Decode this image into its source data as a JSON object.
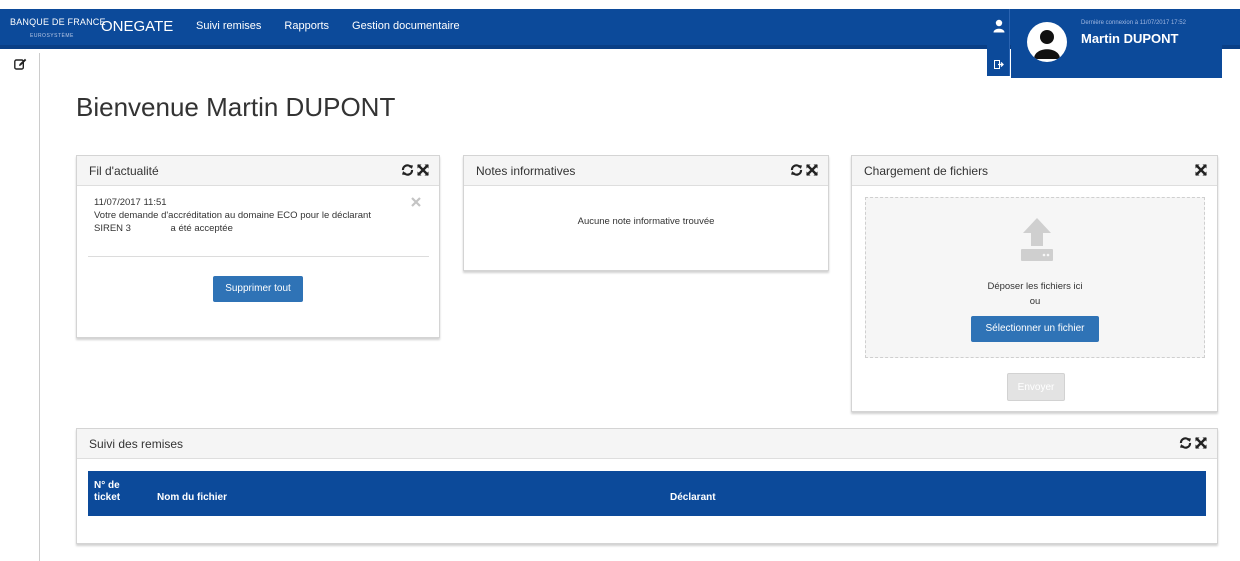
{
  "header": {
    "brand_line": "BANQUE DE FRANCE",
    "brand_sub": "EUROSYSTÈME",
    "app_name": "ONEGATE",
    "nav": [
      "Suivi remises",
      "Rapports",
      "Gestion documentaire"
    ]
  },
  "user": {
    "last_login": "Dernière connexion à 11/07/2017 17:52",
    "name": "Martin DUPONT"
  },
  "page": {
    "title": "Bienvenue Martin DUPONT"
  },
  "panels": {
    "fil": {
      "title": "Fil d'actualité",
      "item_date": "11/07/2017 11:51",
      "item_line1": "Votre demande d'accréditation au domaine ECO pour le déclarant",
      "item_line2": "SIREN 3               a été acceptée",
      "delete_all": "Supprimer tout"
    },
    "notes": {
      "title": "Notes informatives",
      "empty": "Aucune note informative trouvée"
    },
    "upload": {
      "title": "Chargement de fichiers",
      "drop": "Déposer les fichiers ici",
      "or": "ou",
      "select": "Sélectionner un fichier",
      "send": "Envoyer"
    },
    "suivi": {
      "title": "Suivi des remises",
      "columns": [
        "N° de ticket",
        "Nom du fichier",
        "Déclarant"
      ]
    }
  },
  "icons": [
    "user-icon",
    "logout-icon",
    "edit-icon",
    "refresh-icon",
    "expand-icon",
    "close-icon",
    "upload-icon"
  ],
  "colors": {
    "brand_blue": "#0c4a9a",
    "button_blue": "#2f73b6"
  }
}
